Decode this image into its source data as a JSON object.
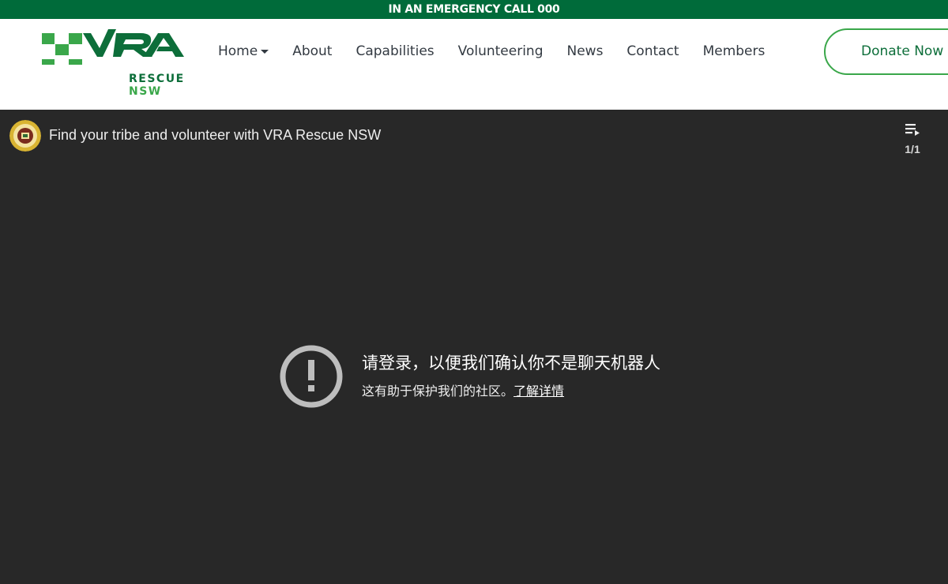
{
  "topbar": {
    "text": "IN AN EMERGENCY CALL 000"
  },
  "logo": {
    "wordmark": "VRA",
    "sub_left": "RESCUE",
    "sub_right": "NSW"
  },
  "nav": {
    "home": "Home",
    "about": "About",
    "capabilities": "Capabilities",
    "volunteering": "Volunteering",
    "news": "News",
    "contact": "Contact",
    "members": "Members",
    "donate": "Donate Now"
  },
  "player": {
    "title": "Find your tribe and volunteer with VRA Rescue NSW",
    "playlist_count": "1/1",
    "error_title": "请登录，以便我们确认你不是聊天机器人",
    "error_sub": "这有助于保护我们的社区。",
    "error_link": "了解详情"
  },
  "colors": {
    "brand_green": "#006b3a",
    "accent_green": "#3aa74a",
    "player_bg": "#282828"
  }
}
